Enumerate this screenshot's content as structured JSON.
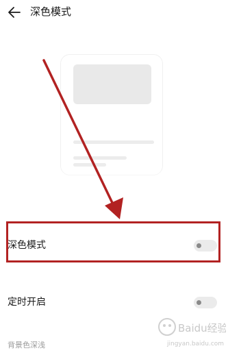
{
  "header": {
    "title": "深色模式",
    "back_icon": "arrow-left-icon"
  },
  "settings": {
    "dark_mode": {
      "label": "深色模式",
      "enabled": false
    },
    "scheduled": {
      "label": "定时开启",
      "enabled": false
    }
  },
  "section_caption": "背景色深浅",
  "watermark": {
    "text": "Baidu经验",
    "subtext": "jingyan.baidu.com"
  },
  "colors": {
    "annotation": "#b22222",
    "toggle_track": "#ebebeb",
    "toggle_knob": "#8a8a8a"
  }
}
